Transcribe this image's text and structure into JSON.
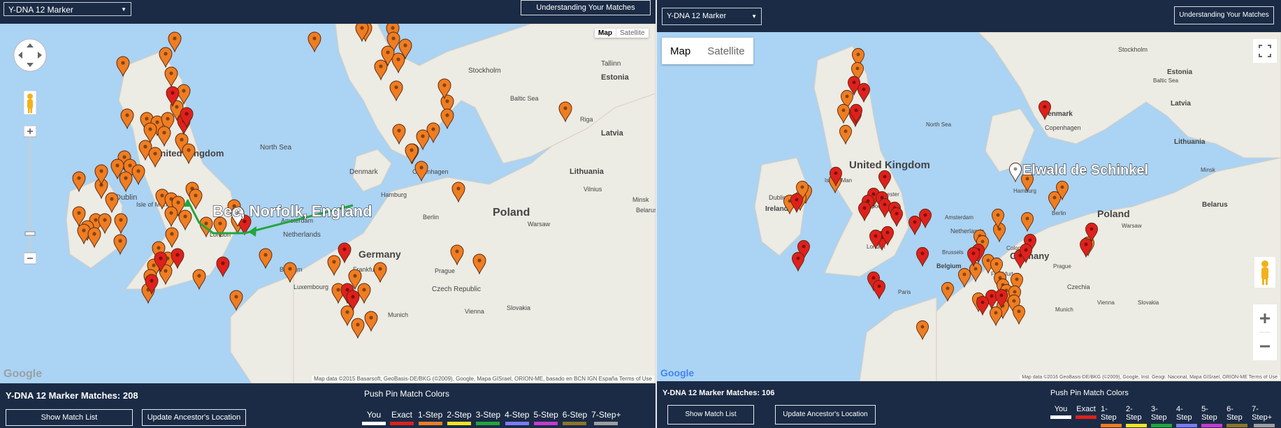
{
  "left": {
    "select_value": "Y-DNA 12 Marker",
    "understanding_btn": "Understanding Your Matches",
    "map": {
      "type_map": "Map",
      "type_satellite": "Satellite",
      "callout_label": "Bec, Norfolk, England",
      "google_logo": "Google",
      "attribution": "Map data ©2015 Basarsoft, GeoBasis-DE/BKG (©2009), Google, Mapa GISrael, ORION-ME, basado en BCN IGN España",
      "terms": "Terms of Use",
      "places": [
        "North Sea",
        "Baltic Sea",
        "Stockholm",
        "Tallinn",
        "Estonia",
        "Riga",
        "Latvia",
        "Lithuania",
        "Vilnius",
        "Minsk",
        "Denmark",
        "Copenhagen",
        "United Kingdom",
        "Isle of Man",
        "Dublin",
        "London",
        "Hamburg",
        "Amsterdam",
        "Netherlands",
        "Berlin",
        "Poland",
        "Warsaw",
        "Belarus",
        "Germany",
        "Belgium",
        "Luxembourg",
        "Frankfurt",
        "Prague",
        "Czech Republic",
        "Munich",
        "Vienna",
        "Slovakia"
      ]
    },
    "bottom": {
      "count": "Y-DNA 12 Marker Matches: 208",
      "show_list": "Show Match List",
      "update_loc": "Update Ancestor's Location",
      "legend_title": "Push Pin Match Colors"
    }
  },
  "right": {
    "select_value": "Y-DNA 12 Marker",
    "understanding_btn": "Understanding Your Matches",
    "map": {
      "type_map": "Map",
      "type_satellite": "Satellite",
      "callout_label": "Elwald de Schinkel",
      "google_logo": "Google",
      "attribution": "Map data ©2016 GeoBasis-DE/BKG (©2009), Google, Inst. Geogr. Nacional, Mapa GISrael, ORION-ME",
      "terms": "Terms of Use",
      "places": [
        "North Sea",
        "Baltic Sea",
        "Stockholm",
        "Copenhagen",
        "Denmark",
        "Estonia",
        "Latvia",
        "Lithuania",
        "Minsk",
        "Belarus",
        "United Kingdom",
        "Isle of Man",
        "Dublin",
        "Ireland",
        "Manchester",
        "Liverpool",
        "London",
        "Amsterdam",
        "Netherlands",
        "Hamburg",
        "Berlin",
        "Poland",
        "Warsaw",
        "Brussels",
        "Belgium",
        "Cologne",
        "Germany",
        "Frankfurt",
        "Prague",
        "Czechia",
        "Munich",
        "Vienna",
        "Slovakia",
        "Paris"
      ]
    },
    "bottom": {
      "count": "Y-DNA 12 Marker Matches: 106",
      "show_list": "Show Match List",
      "update_loc": "Update Ancestor's Location",
      "legend_title": "Push Pin Match Colors"
    }
  },
  "legend_items": [
    {
      "label": "You",
      "color": "#ffffff"
    },
    {
      "label": "Exact",
      "color": "#e0201c"
    },
    {
      "label": "1-Step",
      "color": "#ef7d22"
    },
    {
      "label": "2-Step",
      "color": "#f2e421"
    },
    {
      "label": "3-Step",
      "color": "#23a53c"
    },
    {
      "label": "4-Step",
      "color": "#7b7cf1"
    },
    {
      "label": "5-Step",
      "color": "#c53ad0"
    },
    {
      "label": "6-Step",
      "color": "#8a7528"
    },
    {
      "label": "7-Step+",
      "color": "#9e9e9e"
    }
  ],
  "icons": [
    "pan-control-icon",
    "pegman-icon",
    "zoom-in-icon",
    "zoom-out-icon",
    "fullscreen-icon",
    "map-pin-icon",
    "caret-down-icon"
  ]
}
